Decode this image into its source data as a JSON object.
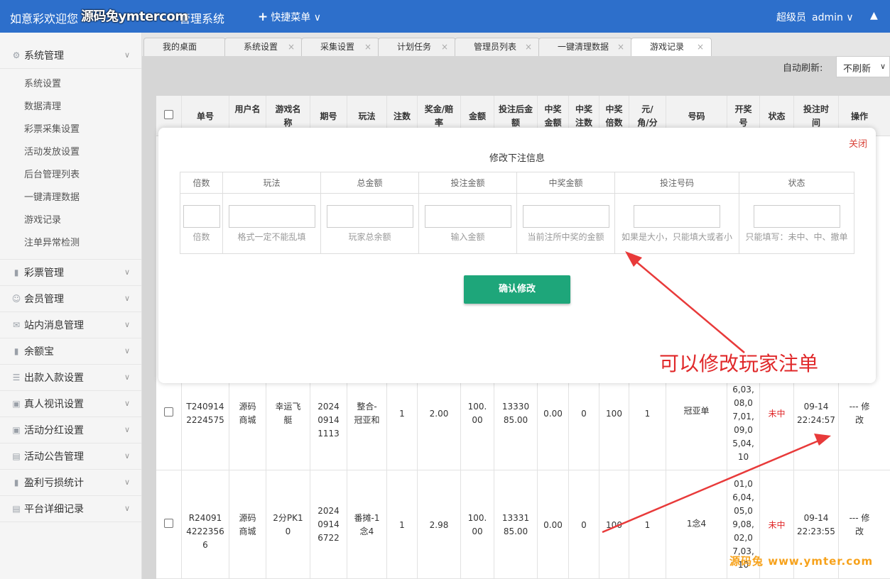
{
  "header": {
    "title_prefix": "如意彩欢迎您",
    "watermark": "源码兔ymtercom",
    "title_suffix": "管理系统",
    "quick_menu": "快捷菜单",
    "role": "超级员",
    "username": "admin"
  },
  "sidebar": {
    "groups": [
      {
        "label": "系统管理",
        "icon": "gear-icon"
      },
      {
        "label": "彩票管理",
        "icon": "chart-icon"
      },
      {
        "label": "会员管理",
        "icon": "user-icon"
      },
      {
        "label": "站内消息管理",
        "icon": "mail-icon"
      },
      {
        "label": "余额宝",
        "icon": "chart-icon"
      },
      {
        "label": "出款入款设置",
        "icon": "list-icon"
      },
      {
        "label": "真人视讯设置",
        "icon": "gift-icon"
      },
      {
        "label": "活动分红设置",
        "icon": "gift-icon"
      },
      {
        "label": "活动公告管理",
        "icon": "doc-icon"
      },
      {
        "label": "盈利亏损统计",
        "icon": "chart-icon"
      },
      {
        "label": "平台详细记录",
        "icon": "doc-icon"
      }
    ],
    "system_items": [
      "系统设置",
      "数据清理",
      "彩票采集设置",
      "活动发放设置",
      "后台管理列表",
      "一键清理数据",
      "游戏记录",
      "注单异常检测"
    ]
  },
  "tabs": [
    {
      "label": "我的桌面",
      "closable": false
    },
    {
      "label": "系统设置",
      "closable": true
    },
    {
      "label": "采集设置",
      "closable": true
    },
    {
      "label": "计划任务",
      "closable": true
    },
    {
      "label": "管理员列表",
      "closable": true
    },
    {
      "label": "一键清理数据",
      "closable": true
    },
    {
      "label": "游戏记录",
      "closable": true,
      "active": true
    }
  ],
  "toolbar": {
    "refresh_label": "自动刷新:",
    "refresh_value": "不刷新"
  },
  "table": {
    "headers": [
      "单号",
      "用户名",
      "游戏名称",
      "期号",
      "玩法",
      "注数",
      "奖金/赔率",
      "金额",
      "投注后金额",
      "中奖金额",
      "中奖注数",
      "中奖倍数",
      "元/角/分",
      "号码",
      "开奖号",
      "状态",
      "投注时间",
      "操作"
    ],
    "rows": [
      {
        "order_no": "T2409142224575",
        "user": "源码商城",
        "game": "幸运飞艇",
        "issue": "202409141113",
        "play": "整合-冠亚和",
        "count": "1",
        "odds": "2.00",
        "amount": "100.00",
        "after": "1333085.00",
        "win_amount": "0.00",
        "win_count": "0",
        "win_multi": "100",
        "unit": "1",
        "number": "冠亚单",
        "draw": "6,03,08,07,01,09,05,04,10",
        "status": "未中",
        "time": "09-14 22:24:57",
        "action": "--- 修改"
      },
      {
        "order_no": "R2409142223566",
        "user": "源码商城",
        "game": "2分PK10",
        "issue": "202409146722",
        "play": "番摊-1念4",
        "count": "1",
        "odds": "2.98",
        "amount": "100.00",
        "after": "1333185.00",
        "win_amount": "0.00",
        "win_count": "0",
        "win_multi": "100",
        "unit": "1",
        "number": "1念4",
        "draw": "01,06,04,05,09,08,02,07,03,10",
        "status": "未中",
        "time": "09-14 22:23:55",
        "action": "--- 修改"
      }
    ]
  },
  "modal": {
    "close_label": "关闭",
    "title": "修改下注信息",
    "columns": [
      {
        "header": "倍数",
        "hint": "倍数"
      },
      {
        "header": "玩法",
        "hint": "格式一定不能乱填"
      },
      {
        "header": "总金额",
        "hint": "玩家总余额"
      },
      {
        "header": "投注金额",
        "hint": "输入金额"
      },
      {
        "header": "中奖金额",
        "hint": "当前注所中奖的金额"
      },
      {
        "header": "投注号码",
        "hint": "如果是大小，只能填大或者小"
      },
      {
        "header": "状态",
        "hint": "只能填写：未中、中、撤单"
      }
    ],
    "confirm_label": "确认修改"
  },
  "annotation": "可以修改玩家注单",
  "footer_watermark": "源码兔 www.ymter.com",
  "colors": {
    "header": "#2d6fcb",
    "confirm": "#1ea67a",
    "annotation": "#e0282a",
    "watermark": "#f7a21b"
  }
}
